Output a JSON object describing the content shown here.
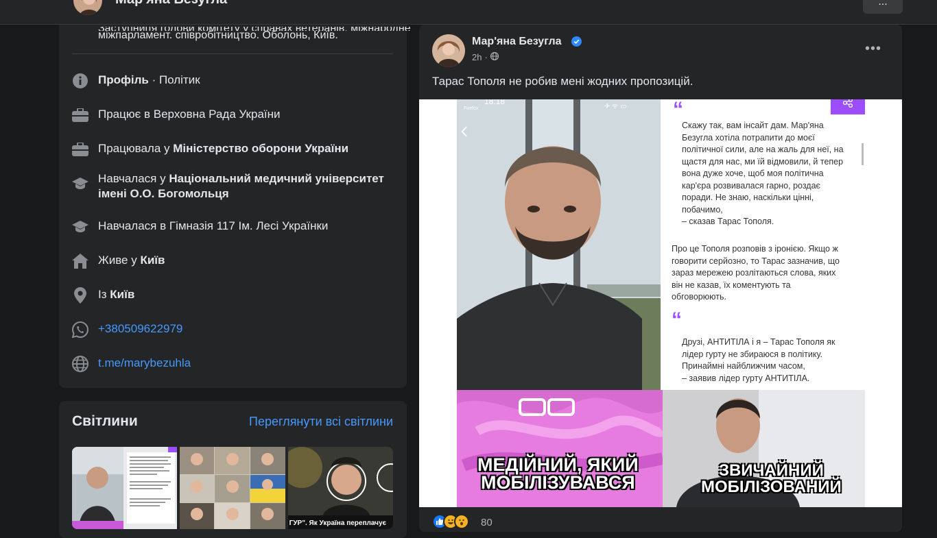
{
  "header": {
    "name": "Мар'яна Безугла",
    "more_button": "..."
  },
  "intro": {
    "bio_cut": "Заступниця голови комітету у справах ветеранів, міжнародне",
    "bio_line": "міжпарламент. співробітництво. Оболонь, Київ.",
    "items": [
      {
        "icon": "info-icon",
        "prefix": "",
        "bold": "Профіль",
        "suffix": " · Політик"
      },
      {
        "icon": "briefcase-icon",
        "prefix": "Працює в Верховна Рада України",
        "bold": "",
        "suffix": ""
      },
      {
        "icon": "briefcase-icon",
        "prefix": "Працювала у ",
        "bold": "Міністерство оборони України",
        "suffix": ""
      },
      {
        "icon": "graduation-cap-icon",
        "prefix": "Навчалася у ",
        "bold": "Національний медичний університет імені О.О. Богомольця",
        "suffix": ""
      },
      {
        "icon": "graduation-cap-icon",
        "prefix": "Навчалася в Гімназія 117 Ім. Лесі Українки",
        "bold": "",
        "suffix": ""
      },
      {
        "icon": "home-icon",
        "prefix": "Живе у ",
        "bold": "Київ",
        "suffix": ""
      },
      {
        "icon": "location-pin-icon",
        "prefix": "Із ",
        "bold": "Київ",
        "suffix": ""
      },
      {
        "icon": "whatsapp-icon",
        "link": "+380509622979"
      },
      {
        "icon": "globe-icon",
        "link": "t.me/marybezuhla"
      }
    ]
  },
  "photos": {
    "title": "Світлини",
    "see_all": "Переглянути всі світлини",
    "caption_3": "ГУР\". Як Україна переплачує"
  },
  "post": {
    "author": "Мар'яна Безугла",
    "time": "2h",
    "text": "Тарас Тополя не робив мені жодних пропозицій.",
    "reactions_count": "80",
    "image": {
      "status_time": "18:18",
      "status_app": "Firefox",
      "quote1": [
        "Скажу так, вам інсайт дам. Мар'яна",
        "Безугла хотіла потрапити до моєї",
        "політичної сили, але на жаль для неї, на",
        "щастя для нас, ми їй відмовили, й тепер",
        "вона дуже хоче, щоб моя політична",
        "кар'єра розвивалася гарно, роздає",
        "поради. Не знаю, наскільки цінні,",
        "побачимо,",
        "– сказав Тарас Тополя."
      ],
      "para": [
        "Про це Тополя розповів з іронією. Якщо ж",
        "говорити серйозно, то Тарас зазначив, що",
        "зараз мережею розлітаються слова, яких",
        "він не казав, їх коментують та",
        "обговорюють."
      ],
      "quote2": [
        "Друзі, АНТИТІЛА і я – Тарас Тополя як",
        "лідер гурту не збираюся в політику.",
        "Принаймні найближчим часом,",
        "– заявив лідер гурту АНТИТІЛА."
      ],
      "meme_left": [
        "МЕДІЙНИЙ, ЯКИЙ",
        "МОБІЛІЗУВАВСЯ"
      ],
      "meme_right": [
        "ЗВИЧАЙНИЙ",
        "МОБІЛІЗОВАНИЙ"
      ]
    }
  },
  "colors": {
    "bg": "#18191a",
    "card": "#242526",
    "link": "#4599ff",
    "verified": "#2e89ff",
    "accent_purple": "#9b4dff"
  }
}
